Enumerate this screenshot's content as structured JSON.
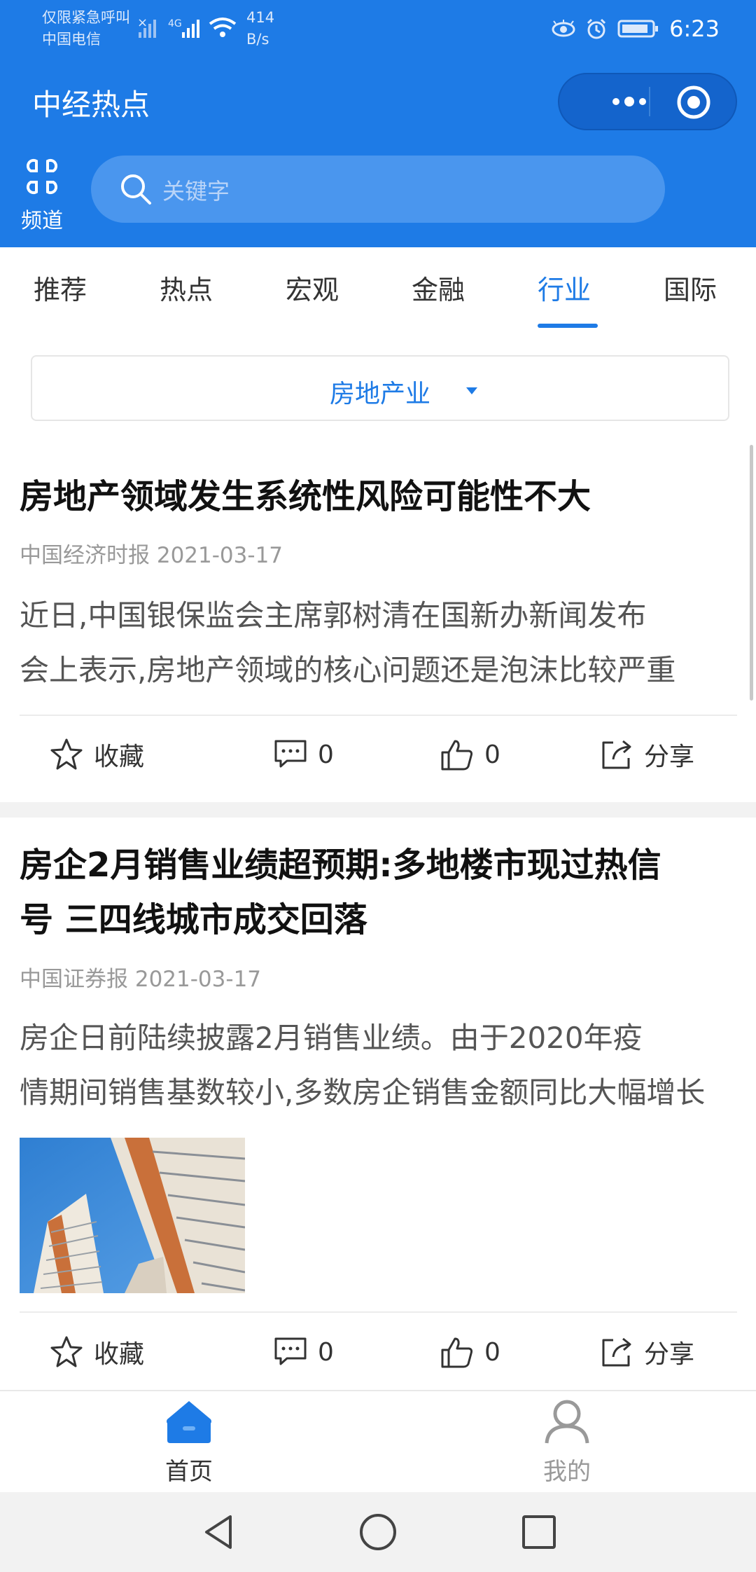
{
  "status_bar": {
    "carrier_line1": "仅限紧急呼叫",
    "carrier_line2": "中国电信",
    "speed_value": "414",
    "speed_unit": "B/s",
    "time": "6:23"
  },
  "app": {
    "title": "中经热点"
  },
  "channel": {
    "label": "频道",
    "icon": "grid-icon"
  },
  "search": {
    "placeholder": "关键字"
  },
  "tabs": [
    {
      "label": "推荐",
      "active": false
    },
    {
      "label": "热点",
      "active": false
    },
    {
      "label": "宏观",
      "active": false
    },
    {
      "label": "金融",
      "active": false
    },
    {
      "label": "行业",
      "active": true
    },
    {
      "label": "国际",
      "active": false
    }
  ],
  "filter": {
    "selected": "房地产业"
  },
  "articles": [
    {
      "title": "房地产领域发生系统性风险可能性不大",
      "source": "中国经济时报 2021-03-17",
      "summary_line1": "近日,中国银保监会主席郭树清在国新办新闻发布",
      "summary_line2": "会上表示,房地产领域的核心问题还是泡沫比较严重",
      "collect_label": "收藏",
      "comment_count": "0",
      "like_count": "0",
      "share_label": "分享"
    },
    {
      "title_line1": "房企2月销售业绩超预期:多地楼市现过热信",
      "title_line2": "号 三四线城市成交回落",
      "source": "中国证券报 2021-03-17",
      "summary_line1": "房企日前陆续披露2月销售业绩。由于2020年疫",
      "summary_line2": "情期间销售基数较小,多数房企销售金额同比大幅增长",
      "collect_label": "收藏",
      "comment_count": "0",
      "like_count": "0",
      "share_label": "分享"
    }
  ],
  "bottom_nav": {
    "home_label": "首页",
    "mine_label": "我的"
  },
  "colors": {
    "primary": "#1e7be6",
    "header_bg": "#1e7be6"
  }
}
